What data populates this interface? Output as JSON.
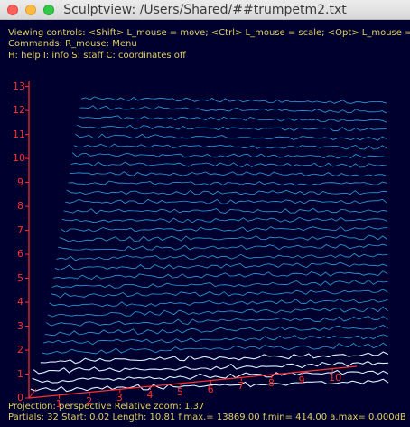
{
  "window": {
    "title": "Sculptview: /Users/Shared/##trumpetm2.txt"
  },
  "overlay": {
    "line1": "Viewing controls: <Shift> L_mouse = move; <Ctrl> L_mouse = scale; <Opt> L_mouse = rot.",
    "line2": "Commands:  R_mouse: Menu",
    "line3": "H: help  I: info  S: staff C: coordinates off",
    "projection": "Projection: perspective   Relative zoom:  1.37",
    "stats": "Partials:    32  Start: 0.02  Length:  10.81  f.max.= 13869.00  f.min= 414.00  a.max=  0.000dB"
  },
  "axes": {
    "y_ticks": [
      "0",
      "1",
      "2",
      "3",
      "4",
      "5",
      "6",
      "7",
      "8",
      "9",
      "10",
      "11",
      "12",
      "13"
    ],
    "x_ticks": [
      "1",
      "2",
      "3",
      "4",
      "5",
      "6",
      "7",
      "8",
      "9",
      "10"
    ]
  },
  "colors": {
    "background": "#00002e",
    "info_text": "#e0d060",
    "axis": "#ff3030",
    "partials": "#2aa0e0",
    "partials_low": "#d8f4ff"
  }
}
